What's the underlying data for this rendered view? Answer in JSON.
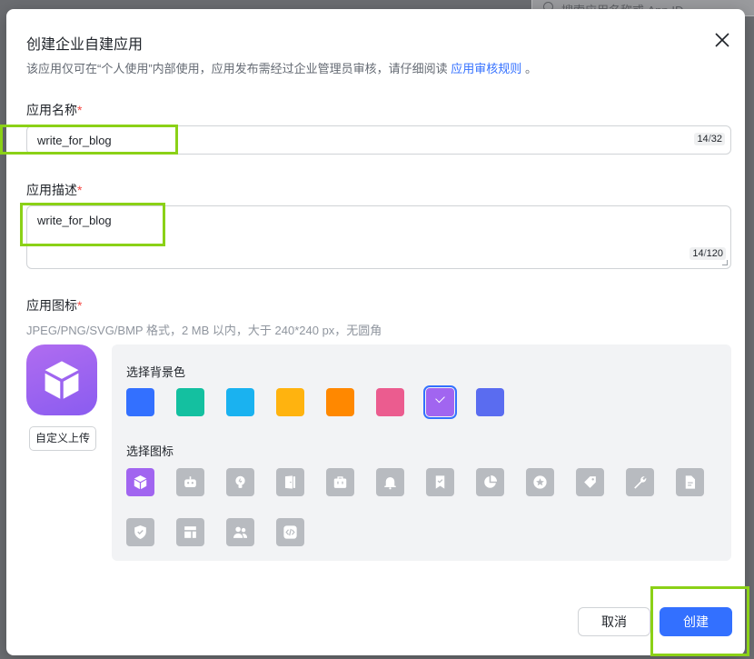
{
  "background": {
    "search_placeholder": "搜索应用名称或 App ID"
  },
  "dialog": {
    "title": "创建企业自建应用",
    "notice_text": "该应用仅可在“个人使用”内部使用，应用发布需经过企业管理员审核，请仔细阅读",
    "notice_link": "应用审核规则",
    "notice_end": "。"
  },
  "name_field": {
    "label": "应用名称",
    "required_mark": "*",
    "value": "write_for_blog",
    "count": "14",
    "max": "32"
  },
  "desc_field": {
    "label": "应用描述",
    "required_mark": "*",
    "value": "write_for_blog",
    "count": "14",
    "max": "120"
  },
  "icon_field": {
    "label": "应用图标",
    "required_mark": "*",
    "hint": "JPEG/PNG/SVG/BMP 格式，2 MB 以内，大于 240*240 px，无圆角",
    "upload_label": "自定义上传",
    "preview_icon": "cube-icon"
  },
  "bg_color_picker": {
    "title": "选择背景色",
    "colors": [
      "#3370ff",
      "#14c0a0",
      "#1ab2f0",
      "#ffb30f",
      "#ff8800",
      "#eb5c8f",
      "#a165f0",
      "#5a6cf0"
    ],
    "selected_index": 6
  },
  "icon_picker": {
    "title": "选择图标",
    "icons": [
      "cube-icon",
      "robot-icon",
      "lightbulb-icon",
      "door-icon",
      "briefcase-icon",
      "bell-icon",
      "bookmark-check-icon",
      "pie-chart-icon",
      "star-badge-icon",
      "tag-icon",
      "wrench-icon",
      "document-icon",
      "shield-check-icon",
      "layout-icon",
      "users-icon",
      "code-icon"
    ],
    "selected_index": 0
  },
  "footer": {
    "cancel_label": "取消",
    "create_label": "创建"
  },
  "colors": {
    "primary": "#3370ff",
    "highlight": "#8bd117",
    "required": "#f54a45"
  }
}
